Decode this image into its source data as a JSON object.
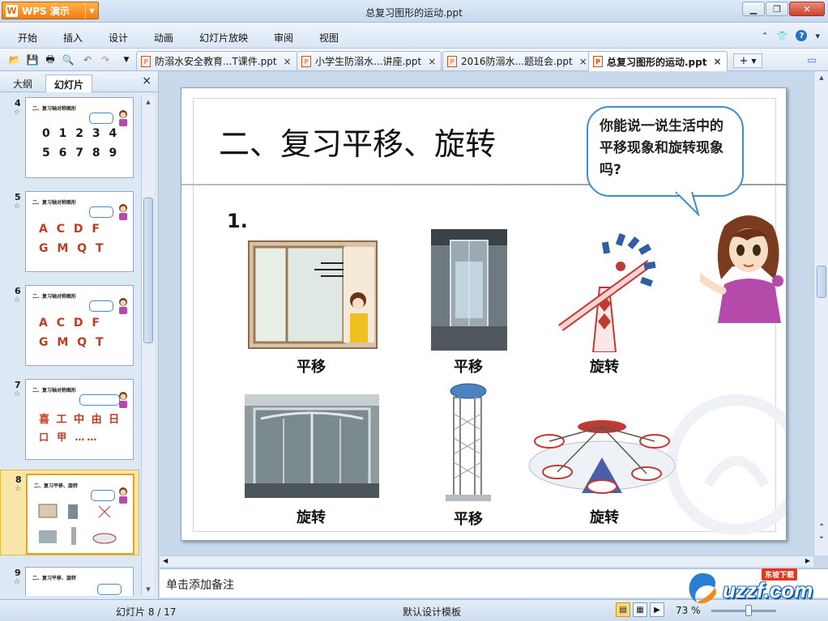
{
  "window": {
    "app_name": "WPS 演示",
    "app_logo_letter": "W",
    "title": "总复习图形的运动.ppt"
  },
  "menu": {
    "items": [
      "开始",
      "插入",
      "设计",
      "动画",
      "幻灯片放映",
      "审阅",
      "视图"
    ]
  },
  "tabs": [
    {
      "label": "防溺水安全教育...T课件.ppt",
      "active": false
    },
    {
      "label": "小学生防溺水...讲座.ppt",
      "active": false
    },
    {
      "label": "2016防溺水...题班会.ppt",
      "active": false
    },
    {
      "label": "总复习图形的运动.ppt",
      "active": true
    }
  ],
  "left_panel": {
    "tab_outline": "大纲",
    "tab_slides": "幻灯片",
    "thumbnails": [
      {
        "num": "4",
        "title": "二、复习轴对称图形",
        "content_lines": [
          "0 1 2 3 4",
          "5 6 7 8 9"
        ]
      },
      {
        "num": "5",
        "title": "二、复习轴对称图形",
        "content_lines": [
          "A C D F",
          "G M Q T"
        ]
      },
      {
        "num": "6",
        "title": "二、复习轴对称图形",
        "content_lines": [
          "A C D F",
          "G M Q T"
        ]
      },
      {
        "num": "7",
        "title": "二、复习轴对称图形",
        "content_lines": [
          "喜 工 中 由 日",
          "口 甲 ……"
        ]
      },
      {
        "num": "8",
        "title": "二、复习平移、旋转",
        "content_lines": [],
        "selected": true
      },
      {
        "num": "9",
        "title": "二、复习平移、旋转",
        "content_lines": []
      }
    ]
  },
  "slide": {
    "title": "二、复习平移、旋转",
    "bubble_text": "你能说一说生活中的平移现象和旋转现象吗?",
    "item_number": "1.",
    "captions": [
      "平移",
      "平移",
      "旋转",
      "旋转",
      "平移",
      "旋转"
    ]
  },
  "notes": {
    "placeholder": "单击添加备注"
  },
  "status": {
    "slide_counter": "幻灯片 8 / 17",
    "template": "默认设计模板",
    "zoom": "73 %"
  },
  "watermark": {
    "text": "uzzf.com",
    "badge": "东坡下载"
  },
  "colors": {
    "accent": "#f07d14",
    "selected_thumb": "#f7e6a8",
    "bubble_border": "#3c8ed0"
  }
}
